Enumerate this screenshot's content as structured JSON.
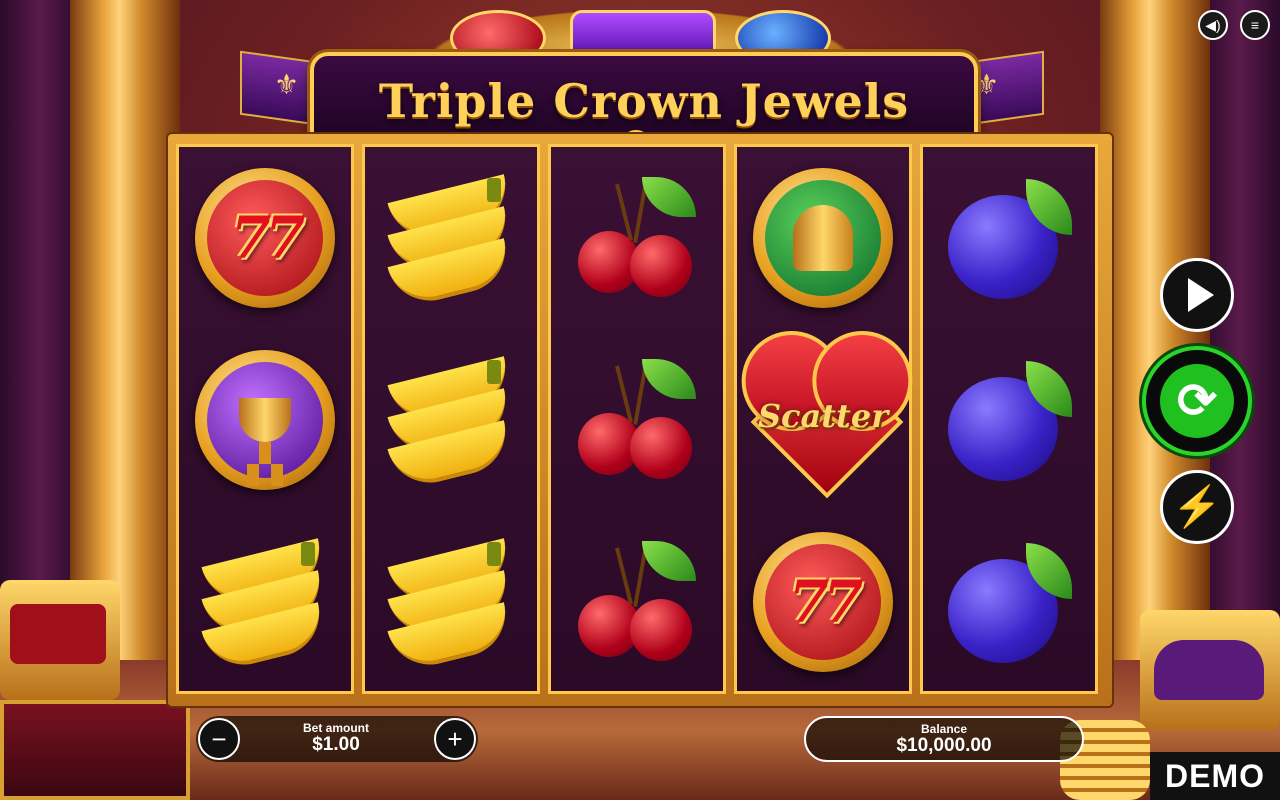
{
  "game": {
    "title": "Triple Crown Jewels"
  },
  "controls": {
    "sound_icon": "speaker-icon",
    "menu_icon": "hamburger-menu-icon",
    "autoplay_icon": "play-icon",
    "spin_icon": "spin-arrows-icon",
    "turbo_icon": "lightning-bolt-icon"
  },
  "reels": [
    [
      "seven",
      "trophy",
      "banana"
    ],
    [
      "banana",
      "banana",
      "banana"
    ],
    [
      "cherry",
      "cherry",
      "cherry"
    ],
    [
      "bell",
      "scatter",
      "seven"
    ],
    [
      "plum",
      "plum",
      "plum"
    ]
  ],
  "symbols": {
    "seven_text": "77",
    "scatter_text": "Scatter"
  },
  "bet": {
    "label": "Bet amount",
    "value": "$1.00",
    "minus": "−",
    "plus": "+"
  },
  "balance": {
    "label": "Balance",
    "value": "$10,000.00"
  },
  "mode_badge": "DEMO",
  "colors": {
    "accent_gold": "#ffcc55",
    "spin_green": "#2ad42a",
    "reel_bg": "#2a0a26"
  }
}
